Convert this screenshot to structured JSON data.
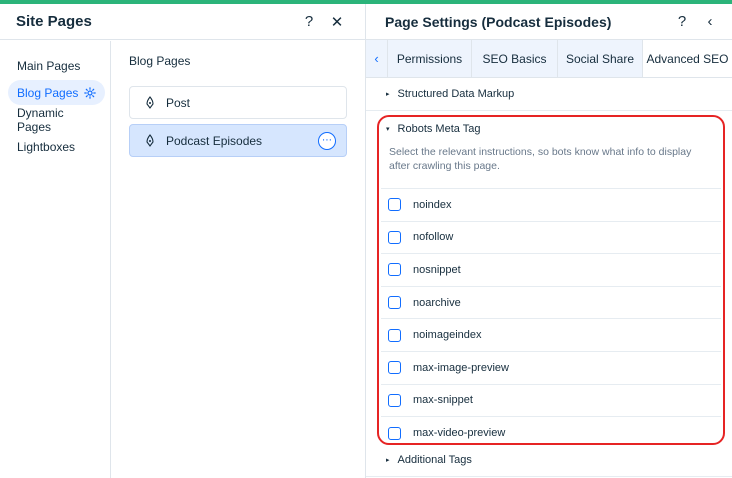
{
  "site_pages": {
    "title": "Site Pages",
    "help_label": "?",
    "close_label": "✕",
    "nav": [
      {
        "label": "Main Pages"
      },
      {
        "label": "Blog Pages"
      },
      {
        "label": "Dynamic Pages"
      },
      {
        "label": "Lightboxes"
      }
    ],
    "list_title": "Blog Pages",
    "pages": [
      {
        "label": "Post"
      },
      {
        "label": "Podcast Episodes",
        "more_label": "⋯"
      }
    ]
  },
  "page_settings": {
    "title": "Page Settings (Podcast Episodes)",
    "help_label": "?",
    "back_label": "‹",
    "tab_arrow_label": "‹",
    "tabs": [
      {
        "label": "Permissions"
      },
      {
        "label": "SEO Basics"
      },
      {
        "label": "Social Share"
      },
      {
        "label": "Advanced SEO"
      }
    ],
    "structured_data": {
      "label": "Structured Data Markup",
      "toggle": "▸"
    },
    "robots": {
      "label": "Robots Meta Tag",
      "toggle": "▾",
      "description": "Select the relevant instructions, so bots know what info to display after crawling this page.",
      "options": [
        {
          "label": "noindex",
          "checked": false
        },
        {
          "label": "nofollow",
          "checked": false
        },
        {
          "label": "nosnippet",
          "checked": false
        },
        {
          "label": "noarchive",
          "checked": false
        },
        {
          "label": "noimageindex",
          "checked": false
        },
        {
          "label": "max-image-preview",
          "checked": false
        },
        {
          "label": "max-snippet",
          "checked": false
        },
        {
          "label": "max-video-preview",
          "checked": false
        }
      ]
    },
    "additional_tags": {
      "label": "Additional Tags",
      "toggle": "▸"
    }
  },
  "colors": {
    "accent": "#116dff",
    "highlight": "#e62424",
    "top_bar": "#2bb47a"
  }
}
